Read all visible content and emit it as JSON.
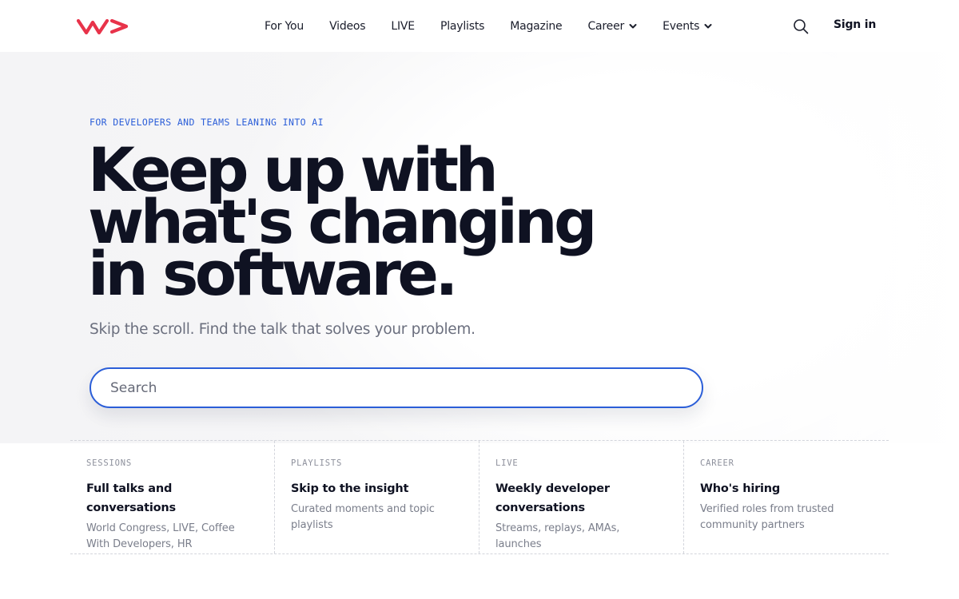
{
  "brand": {
    "logo_icon": "wearedevelopers-logo-icon",
    "accent_color": "#e8334a"
  },
  "nav": {
    "items": [
      {
        "label": "For You",
        "has_dropdown": false
      },
      {
        "label": "Videos",
        "has_dropdown": false
      },
      {
        "label": "LIVE",
        "has_dropdown": false
      },
      {
        "label": "Playlists",
        "has_dropdown": false
      },
      {
        "label": "Magazine",
        "has_dropdown": false
      },
      {
        "label": "Career",
        "has_dropdown": true
      },
      {
        "label": "Events",
        "has_dropdown": true
      }
    ],
    "search_icon": "search-icon",
    "signin_label": "Sign in"
  },
  "hero": {
    "eyebrow": "FOR DEVELOPERS AND TEAMS LEANING INTO AI",
    "headline_lines": [
      "Keep up with",
      "what's changing",
      "in software."
    ],
    "subhead": "Skip the scroll. Find the talk that solves your problem.",
    "search_placeholder": "Search",
    "search_value": "",
    "search_border_color": "#2b5ed8"
  },
  "cards": [
    {
      "eyebrow": "SESSIONS",
      "title": "Full talks and conversations",
      "desc": "World Congress, LIVE, Coffee With Developers, HR"
    },
    {
      "eyebrow": "PLAYLISTS",
      "title": "Skip to the insight",
      "desc": "Curated moments and topic playlists"
    },
    {
      "eyebrow": "LIVE",
      "title": "Weekly developer conversations",
      "desc": "Streams, replays, AMAs, launches"
    },
    {
      "eyebrow": "CAREER",
      "title": "Who's hiring",
      "desc": "Verified roles from trusted community partners"
    }
  ]
}
